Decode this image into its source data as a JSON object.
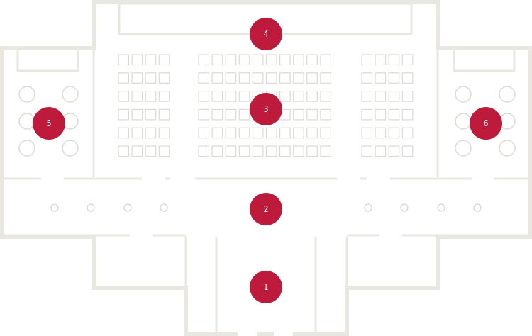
{
  "markers": [
    {
      "id": "1",
      "label": "1"
    },
    {
      "id": "2",
      "label": "2"
    },
    {
      "id": "3",
      "label": "3"
    },
    {
      "id": "4",
      "label": "4"
    },
    {
      "id": "5",
      "label": "5"
    },
    {
      "id": "6",
      "label": "6"
    }
  ],
  "colors": {
    "marker": "#be1b3c",
    "wall": "#e9e7e1",
    "seat_outline": "#dcdad4",
    "background": "#ffffff"
  }
}
